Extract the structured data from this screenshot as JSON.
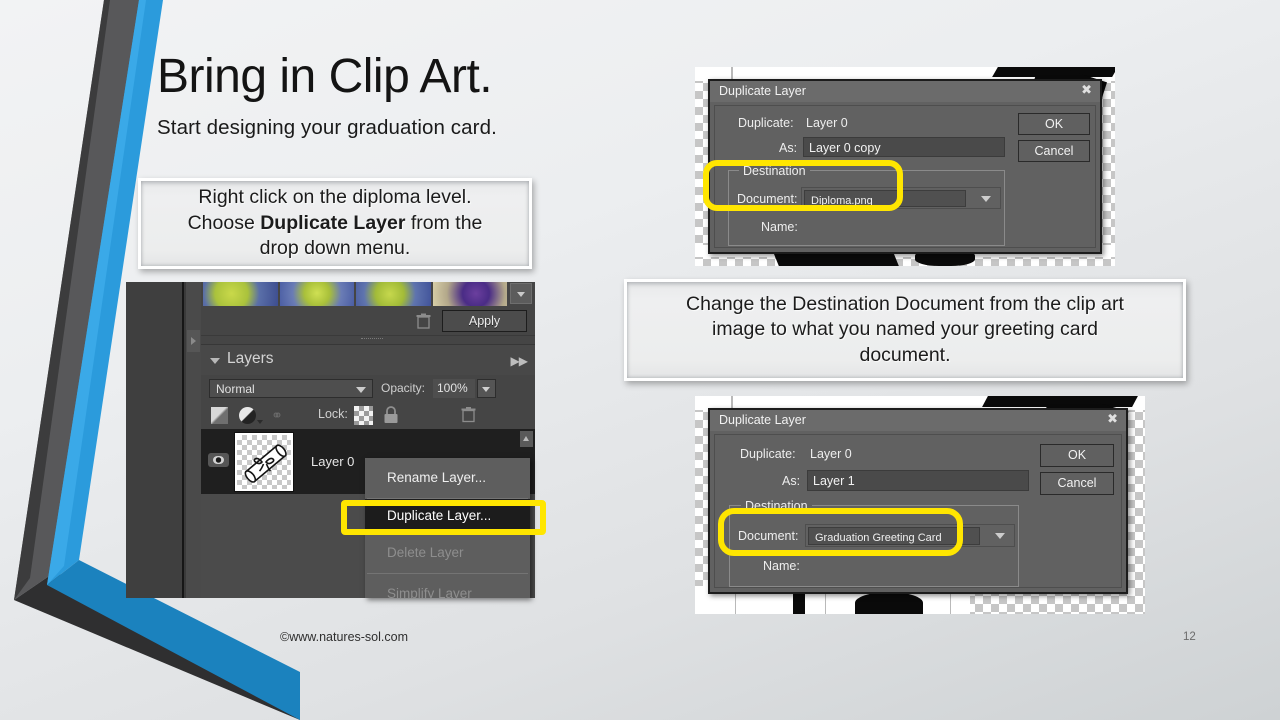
{
  "slide": {
    "title": "Bring in Clip Art.",
    "subtitle": "Start designing your graduation card.",
    "footer_credit": "©www.natures-sol.com",
    "page_number": "12",
    "accent_color": "#2b9bdc",
    "highlight_color": "#ffe600"
  },
  "callouts": {
    "instructions": {
      "line1": "Right click on the diploma level.",
      "line2_pre": "Choose ",
      "line2_bold": "Duplicate Layer",
      "line2_post": " from the",
      "line3": "drop down menu."
    },
    "destination": {
      "line1": "Change the Destination Document from the clip art",
      "line2": "image to what you named your greeting card",
      "line3": "document."
    }
  },
  "photoshop": {
    "apply_button": "Apply",
    "trash_icon": "trash-icon",
    "filmstrip_scroll_icon": "chevron-down-icon",
    "panel_caret_icon": "chevron-down-icon",
    "panel_title": "Layers",
    "panel_more_icon": "double-chevron-right-icon",
    "blend_mode": "Normal",
    "blend_caret_icon": "chevron-down-icon",
    "opacity_label": "Opacity:",
    "opacity_value": "100%",
    "opacity_caret_icon": "chevron-down-icon",
    "lock_label": "Lock:",
    "lock_transparency_icon": "checkerboard-icon",
    "lock_all_icon": "padlock-icon",
    "gradient_mask_icon": "gradient-mask-icon",
    "adjustment_icon": "adjustment-layer-icon",
    "link_icon": "link-layers-icon",
    "eye_icon": "eye-visibility-icon",
    "layer_name": "Layer 0",
    "layer_thumbnail_icon": "diploma-scroll-icon",
    "scroll_up_icon": "chevron-up-icon",
    "context_menu": [
      {
        "label": "Rename Layer...",
        "state": "normal"
      },
      {
        "label": "Duplicate Layer...",
        "state": "selected"
      },
      {
        "label": "Delete Layer",
        "state": "disabled"
      },
      {
        "label": "Simplify Layer",
        "state": "disabled"
      }
    ]
  },
  "dialog_top": {
    "title": "Duplicate Layer",
    "close_icon": "close-icon",
    "duplicate_label": "Duplicate:",
    "duplicate_value": "Layer 0",
    "as_label": "As:",
    "as_value": "Layer 0 copy",
    "ok_button": "OK",
    "cancel_button": "Cancel",
    "destination_legend": "Destination",
    "document_label": "Document:",
    "document_value": "Diploma.png",
    "document_caret_icon": "chevron-down-icon",
    "name_label": "Name:"
  },
  "dialog_bottom": {
    "title": "Duplicate Layer",
    "close_icon": "close-icon",
    "duplicate_label": "Duplicate:",
    "duplicate_value": "Layer 0",
    "as_label": "As:",
    "as_value": "Layer 1",
    "ok_button": "OK",
    "cancel_button": "Cancel",
    "destination_legend": "Destination",
    "document_label": "Document:",
    "document_value": "Graduation Greeting Card",
    "document_caret_icon": "chevron-down-icon",
    "name_label": "Name:"
  }
}
